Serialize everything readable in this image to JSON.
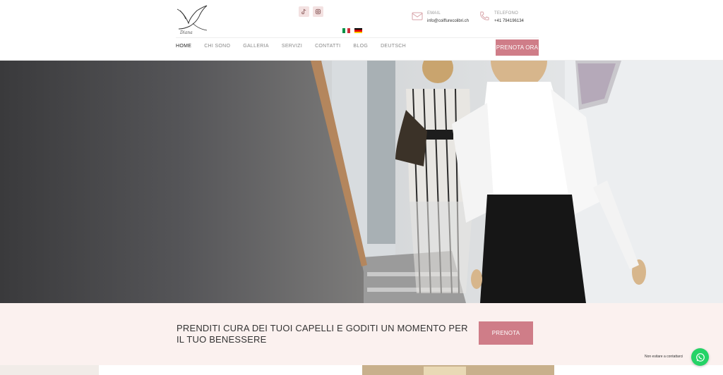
{
  "header": {
    "email_label": "EMAIL",
    "email_value": "info@coiffurecolibri.ch",
    "phone_label": "TELEFONO",
    "phone_value": "+41 794196134",
    "social_icons": [
      "tiktok-icon",
      "instagram-icon"
    ],
    "languages": [
      "it",
      "de"
    ]
  },
  "nav": {
    "items": [
      "HOME",
      "CHI SONO",
      "GALLERIA",
      "SERVIZI",
      "CONTATTI",
      "BLOG",
      "DEUTSCH"
    ],
    "active": "HOME",
    "cta": "PRENOTA ORA"
  },
  "cta_band": {
    "text": "PRENDITI CURA DEI TUOI CAPELLI E GODITI UN MOMENTO PER IL TUO BENESSERE",
    "button": "PRENOTA"
  },
  "whatsapp": {
    "label": "Non esitare a contattarci"
  },
  "colors": {
    "accent": "#cf7d88",
    "band_bg": "#fbf1ef",
    "whatsapp": "#25d366"
  }
}
